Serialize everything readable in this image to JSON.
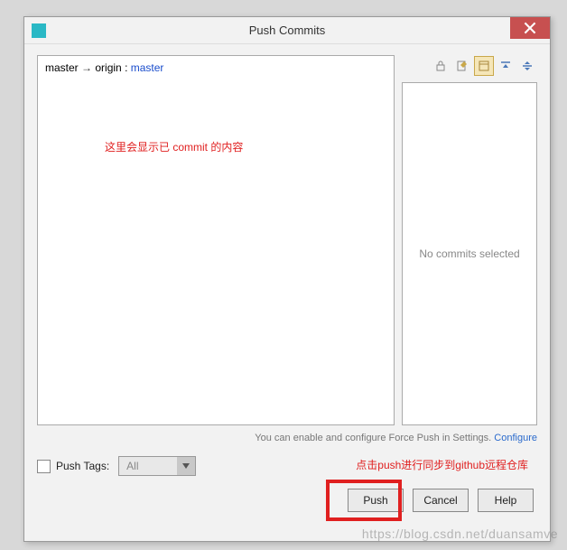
{
  "titlebar": {
    "title": "Push Commits"
  },
  "branch": {
    "local": "master",
    "arrow": "→",
    "remoteName": "origin",
    "colon": " : ",
    "remoteBranch": "master"
  },
  "annotations": {
    "leftPanel": "这里会显示已 commit 的内容",
    "bottom": "点击push进行同步到github远程仓库"
  },
  "rightPanel": {
    "placeholder": "No commits selected"
  },
  "hint": {
    "text": "You can enable and configure Force Push in Settings. ",
    "link": "Configure"
  },
  "pushTags": {
    "label": "Push Tags:",
    "value": "All"
  },
  "buttons": {
    "push": "Push",
    "cancel": "Cancel",
    "help": "Help"
  },
  "watermark": "https://blog.csdn.net/duansamve"
}
